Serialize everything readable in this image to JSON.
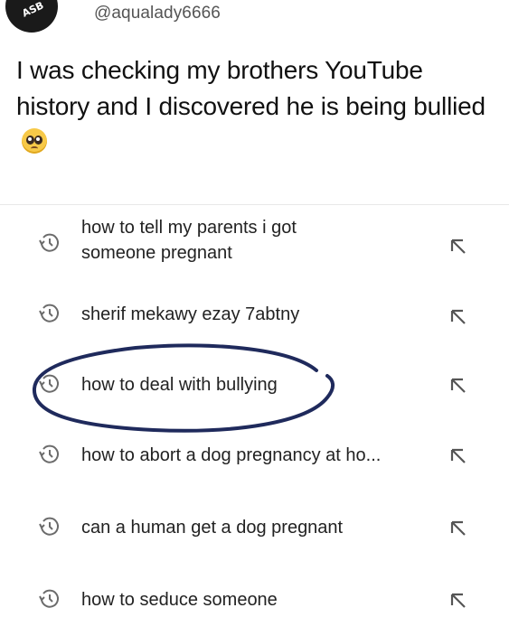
{
  "tweet": {
    "handle": "@aqualady6666",
    "text": "I was checking my brothers YouTube history and I discovered he is being bullied",
    "emoji": "pleading-face",
    "avatar_text": "ASB"
  },
  "history": {
    "items": [
      {
        "line1": "how to tell my parents i got",
        "line2": "someone pregnant",
        "icon": "history-clock-icon",
        "action_icon": "insert-arrow-icon"
      },
      {
        "line1": "sherif mekawy ezay 7abtny",
        "icon": "history-clock-icon",
        "action_icon": "insert-arrow-icon"
      },
      {
        "line1": "how to deal with bullying",
        "icon": "history-clock-icon",
        "action_icon": "insert-arrow-icon",
        "circled": true
      },
      {
        "line1": "how to abort a dog pregnancy at ho...",
        "icon": "history-clock-icon",
        "action_icon": "insert-arrow-icon"
      },
      {
        "line1": "can a human get a dog pregnant",
        "icon": "history-clock-icon",
        "action_icon": "insert-arrow-icon"
      },
      {
        "line1": "how to seduce someone",
        "icon": "history-clock-icon",
        "action_icon": "insert-arrow-icon"
      }
    ]
  },
  "colors": {
    "annotation": "#1f2a5c",
    "icon": "#6b6b6b",
    "text": "#222222"
  }
}
